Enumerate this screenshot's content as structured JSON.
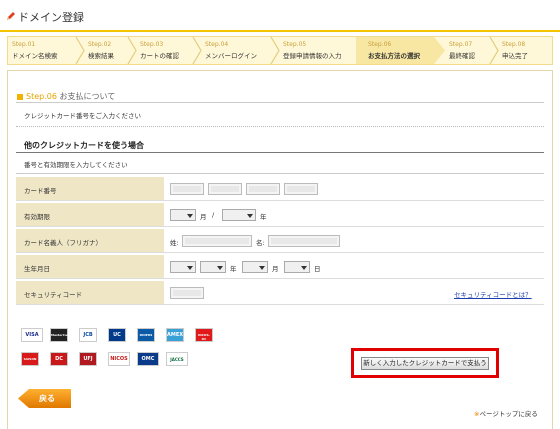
{
  "header": {
    "title": "ドメイン登録"
  },
  "steps": [
    {
      "num": "Step.01",
      "label": "ドメイン名検索"
    },
    {
      "num": "Step.02",
      "label": "検索結果"
    },
    {
      "num": "Step.03",
      "label": "カートの確認"
    },
    {
      "num": "Step.04",
      "label": "メンバーログイン"
    },
    {
      "num": "Step.05",
      "label": "登録申請情報の入力"
    },
    {
      "num": "Step.06",
      "label": "お支払方法の選択"
    },
    {
      "num": "Step.07",
      "label": "最終確認"
    },
    {
      "num": "Step.08",
      "label": "申込完了"
    }
  ],
  "current_step": 6,
  "section": {
    "step": "Step.06",
    "title": "お支払について",
    "instruction": "クレジットカード番号をご入力ください"
  },
  "other_card": {
    "heading": "他のクレジットカードを使う場合",
    "sub": "番号と有効期限を入力してください"
  },
  "form": {
    "card_number_label": "カード番号",
    "expiry_label": "有効期限",
    "expiry_month_unit": "月",
    "expiry_sep": "/",
    "expiry_year_unit": "年",
    "holder_label": "カード名義人（フリガナ）",
    "holder_last": "姓:",
    "holder_first": "名:",
    "birth_label": "生年月日",
    "birth_year_unit": "年",
    "birth_month_unit": "月",
    "birth_day_unit": "日",
    "security_label": "セキュリティコード",
    "security_link": "セキュリティコードとは？"
  },
  "brands": [
    "VISA",
    "MasterCard",
    "JCB",
    "UC",
    "DINERS",
    "AMEX",
    "NICOS-DC",
    "SAISON",
    "DC",
    "UFJ",
    "NICOS",
    "OMC",
    "JACCS"
  ],
  "buttons": {
    "submit": "新しく入力したクレジットカードで支払う",
    "back": "戻る"
  },
  "footer": {
    "pagetop_mark": "※",
    "pagetop": "ページトップに戻る"
  },
  "colors": {
    "accent": "#f5c400",
    "highlight": "#e00000",
    "table_header": "#efe6c6",
    "step_bg": "#fff8d8"
  }
}
